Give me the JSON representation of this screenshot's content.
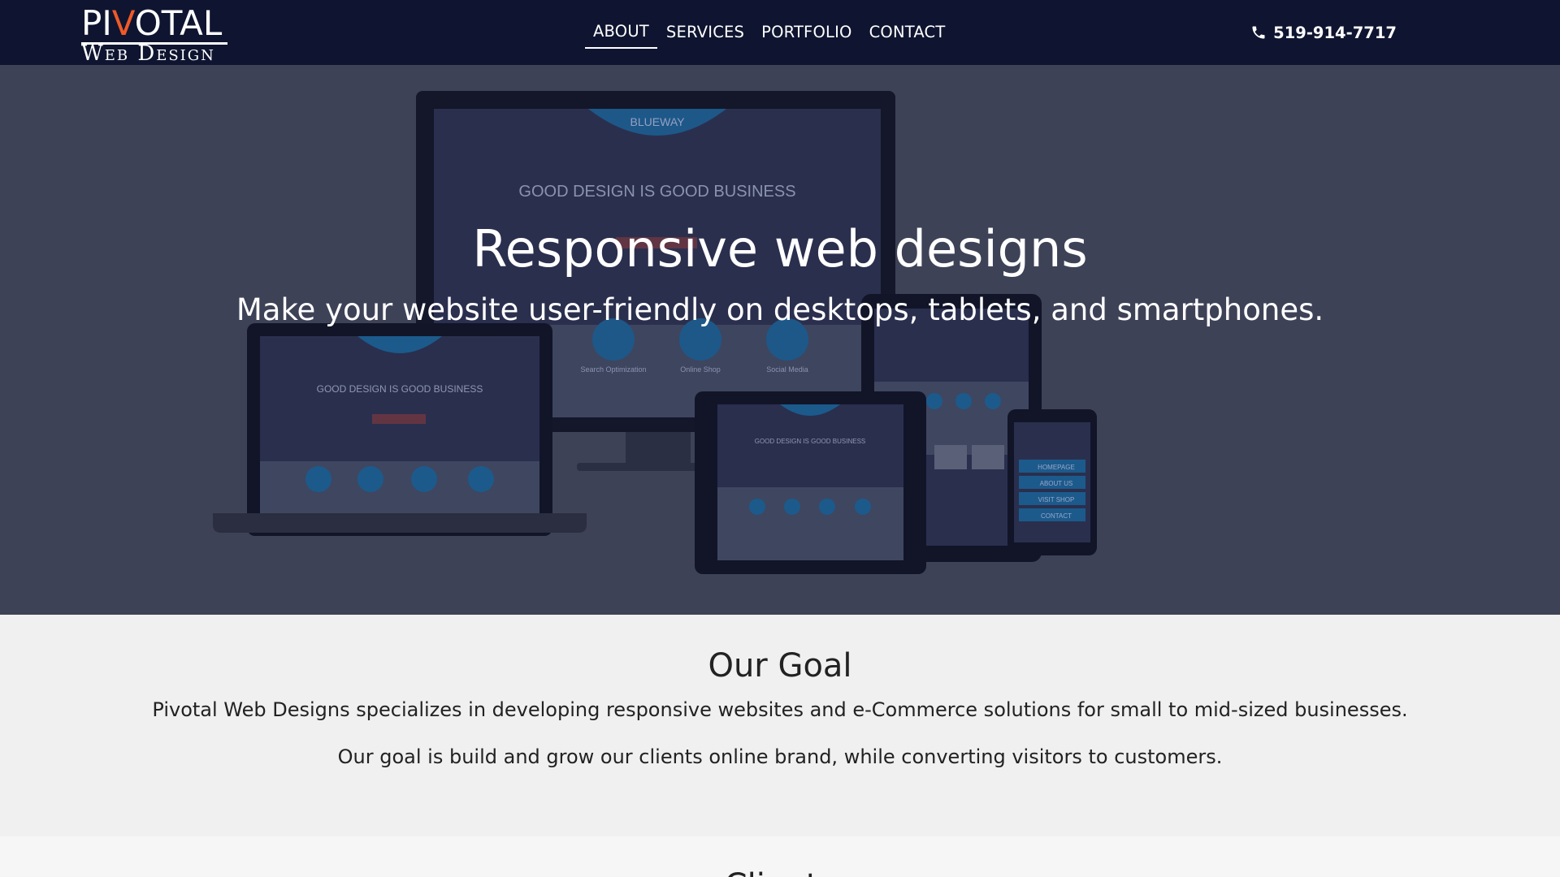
{
  "brand": {
    "logo_top_a": "PI",
    "logo_top_v": "V",
    "logo_top_b": "OTAL",
    "logo_bottom": "Web Design",
    "accent": "#f05a28"
  },
  "nav": {
    "items": [
      {
        "label": "ABOUT",
        "active": true
      },
      {
        "label": "SERVICES"
      },
      {
        "label": "PORTFOLIO"
      },
      {
        "label": "CONTACT"
      }
    ],
    "phone": "519-914-7717",
    "phone_icon": "phone-icon"
  },
  "hero": {
    "title": "Responsive web designs",
    "subtitle": "Make your website user-friendly on desktops, tablets, and smartphones.",
    "mock_brand": "BLUEWAY",
    "mock_headline": "GOOD DESIGN IS GOOD BUSINESS",
    "mock_icons": [
      "Search Optimization",
      "Online Shop",
      "Social Media"
    ],
    "phone_menu": [
      "HOMEPAGE",
      "ABOUT US",
      "VISIT SHOP",
      "CONTACT"
    ]
  },
  "goal": {
    "title": "Our Goal",
    "p1": "Pivotal Web Designs specializes in developing responsive websites and e-Commerce solutions for small to mid-sized businesses.",
    "p2": "Our goal is build and grow our clients online brand, while converting visitors to customers."
  },
  "clients": {
    "title": "Clients"
  },
  "colors": {
    "navbar": "#0f1530",
    "hero": "#3e4257",
    "section": "#f0f0f0"
  }
}
